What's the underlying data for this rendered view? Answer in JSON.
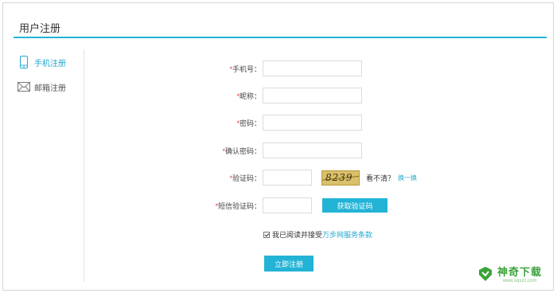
{
  "page": {
    "title": "用户注册"
  },
  "sidebar": {
    "items": [
      {
        "label": "手机注册",
        "icon": "phone-icon",
        "active": true
      },
      {
        "label": "邮箱注册",
        "icon": "mail-icon",
        "active": false
      }
    ]
  },
  "form": {
    "required_mark": "*",
    "phone": {
      "label": "手机号：",
      "value": ""
    },
    "nickname": {
      "label": "昵称：",
      "value": ""
    },
    "password": {
      "label": "密码：",
      "value": ""
    },
    "confirm_password": {
      "label": "确认密码：",
      "value": ""
    },
    "captcha": {
      "label": "验证码：",
      "value": "",
      "image_text": "8239",
      "unclear_text": "看不清？",
      "refresh_link": "换一换"
    },
    "sms": {
      "label": "短信验证码：",
      "value": "",
      "button": "获取验证码"
    },
    "agree": {
      "checked": true,
      "prefix": "我已阅读并接受",
      "terms_link": "万步网服务条款"
    },
    "submit": "立即注册"
  },
  "watermark": {
    "name": "神奇下载",
    "url": "www.sqxzz.com"
  },
  "colors": {
    "accent": "#22b3d6",
    "link": "#22a9d0",
    "required": "#e4393c"
  }
}
